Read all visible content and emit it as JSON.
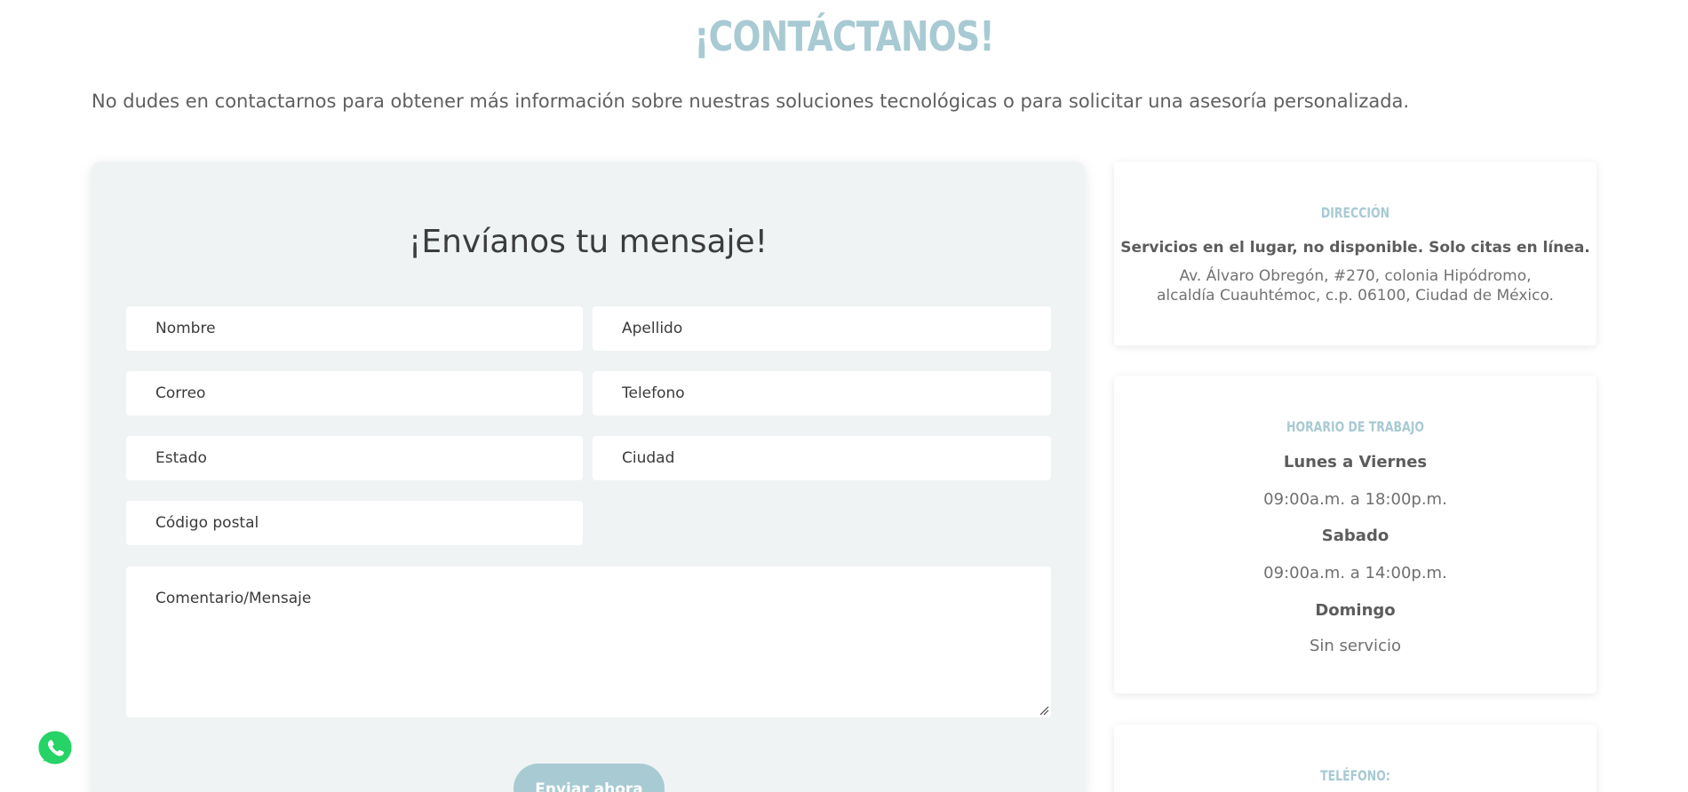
{
  "header": {
    "title": "¡CONTÁCTANOS!",
    "intro": "No dudes en contactarnos para obtener más información sobre nuestras soluciones tecnológicas o para solicitar una asesoría personalizada."
  },
  "form": {
    "title": "¡Envíanos tu mensaje!",
    "fields": {
      "nombre": "Nombre",
      "apellido": "Apellido",
      "correo": "Correo",
      "telefono": "Telefono",
      "estado": "Estado",
      "ciudad": "Ciudad",
      "codigo_postal": "Código postal",
      "comentario": "Comentario/Mensaje"
    },
    "submit_label": "Enviar ahora"
  },
  "cards": {
    "direccion": {
      "heading": "DIRECCIÓN",
      "bold_line": "Servicios en el lugar, no disponible. Solo citas en línea.",
      "address": "Av. Álvaro Obregón, #270, colonia Hipódromo, alcaldía Cuauhtémoc, c.p. 06100, Ciudad de México."
    },
    "horario": {
      "heading": "HORARIO DE TRABAJO",
      "items": [
        {
          "label": "Lunes a Viernes",
          "value": "09:00a.m. a 18:00p.m."
        },
        {
          "label": "Sabado",
          "value": "09:00a.m. a 14:00p.m."
        },
        {
          "label": "Domingo",
          "value": "Sin servicio"
        }
      ]
    },
    "telefono": {
      "heading": "TELÉFONO:"
    }
  },
  "floating": {
    "whatsapp_icon": "whatsapp-icon"
  },
  "colors": {
    "accent": "#a8cad3",
    "panel_bg": "#eff3f4",
    "whatsapp_green": "#25d366"
  }
}
